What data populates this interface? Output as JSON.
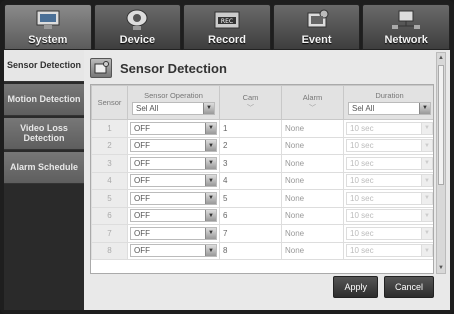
{
  "tabs": [
    {
      "label": "System",
      "icon": "monitor-icon",
      "active": true
    },
    {
      "label": "Device",
      "icon": "camera-icon",
      "active": false
    },
    {
      "label": "Record",
      "icon": "record-icon",
      "active": false
    },
    {
      "label": "Event",
      "icon": "event-icon",
      "active": false
    },
    {
      "label": "Network",
      "icon": "network-icon",
      "active": false
    }
  ],
  "sidebar": {
    "items": [
      {
        "label": "Sensor Detection",
        "active": true
      },
      {
        "label": "Motion Detection",
        "active": false
      },
      {
        "label": "Video Loss Detection",
        "active": false
      },
      {
        "label": "Alarm Schedule",
        "active": false
      }
    ]
  },
  "page": {
    "title": "Sensor Detection"
  },
  "table": {
    "headers": {
      "sensor": "Sensor",
      "operation": "Sensor Operation",
      "operation_all": "Sel All",
      "cam": "Cam",
      "alarm": "Alarm",
      "duration": "Duration",
      "duration_all": "Sel All"
    },
    "rows": [
      {
        "sensor": "1",
        "operation": "OFF",
        "cam": "1",
        "alarm": "None",
        "duration": "10 sec"
      },
      {
        "sensor": "2",
        "operation": "OFF",
        "cam": "2",
        "alarm": "None",
        "duration": "10 sec"
      },
      {
        "sensor": "3",
        "operation": "OFF",
        "cam": "3",
        "alarm": "None",
        "duration": "10 sec"
      },
      {
        "sensor": "4",
        "operation": "OFF",
        "cam": "4",
        "alarm": "None",
        "duration": "10 sec"
      },
      {
        "sensor": "5",
        "operation": "OFF",
        "cam": "5",
        "alarm": "None",
        "duration": "10 sec"
      },
      {
        "sensor": "6",
        "operation": "OFF",
        "cam": "6",
        "alarm": "None",
        "duration": "10 sec"
      },
      {
        "sensor": "7",
        "operation": "OFF",
        "cam": "7",
        "alarm": "None",
        "duration": "10 sec"
      },
      {
        "sensor": "8",
        "operation": "OFF",
        "cam": "8",
        "alarm": "None",
        "duration": "10 sec"
      }
    ]
  },
  "buttons": {
    "apply": "Apply",
    "cancel": "Cancel"
  }
}
